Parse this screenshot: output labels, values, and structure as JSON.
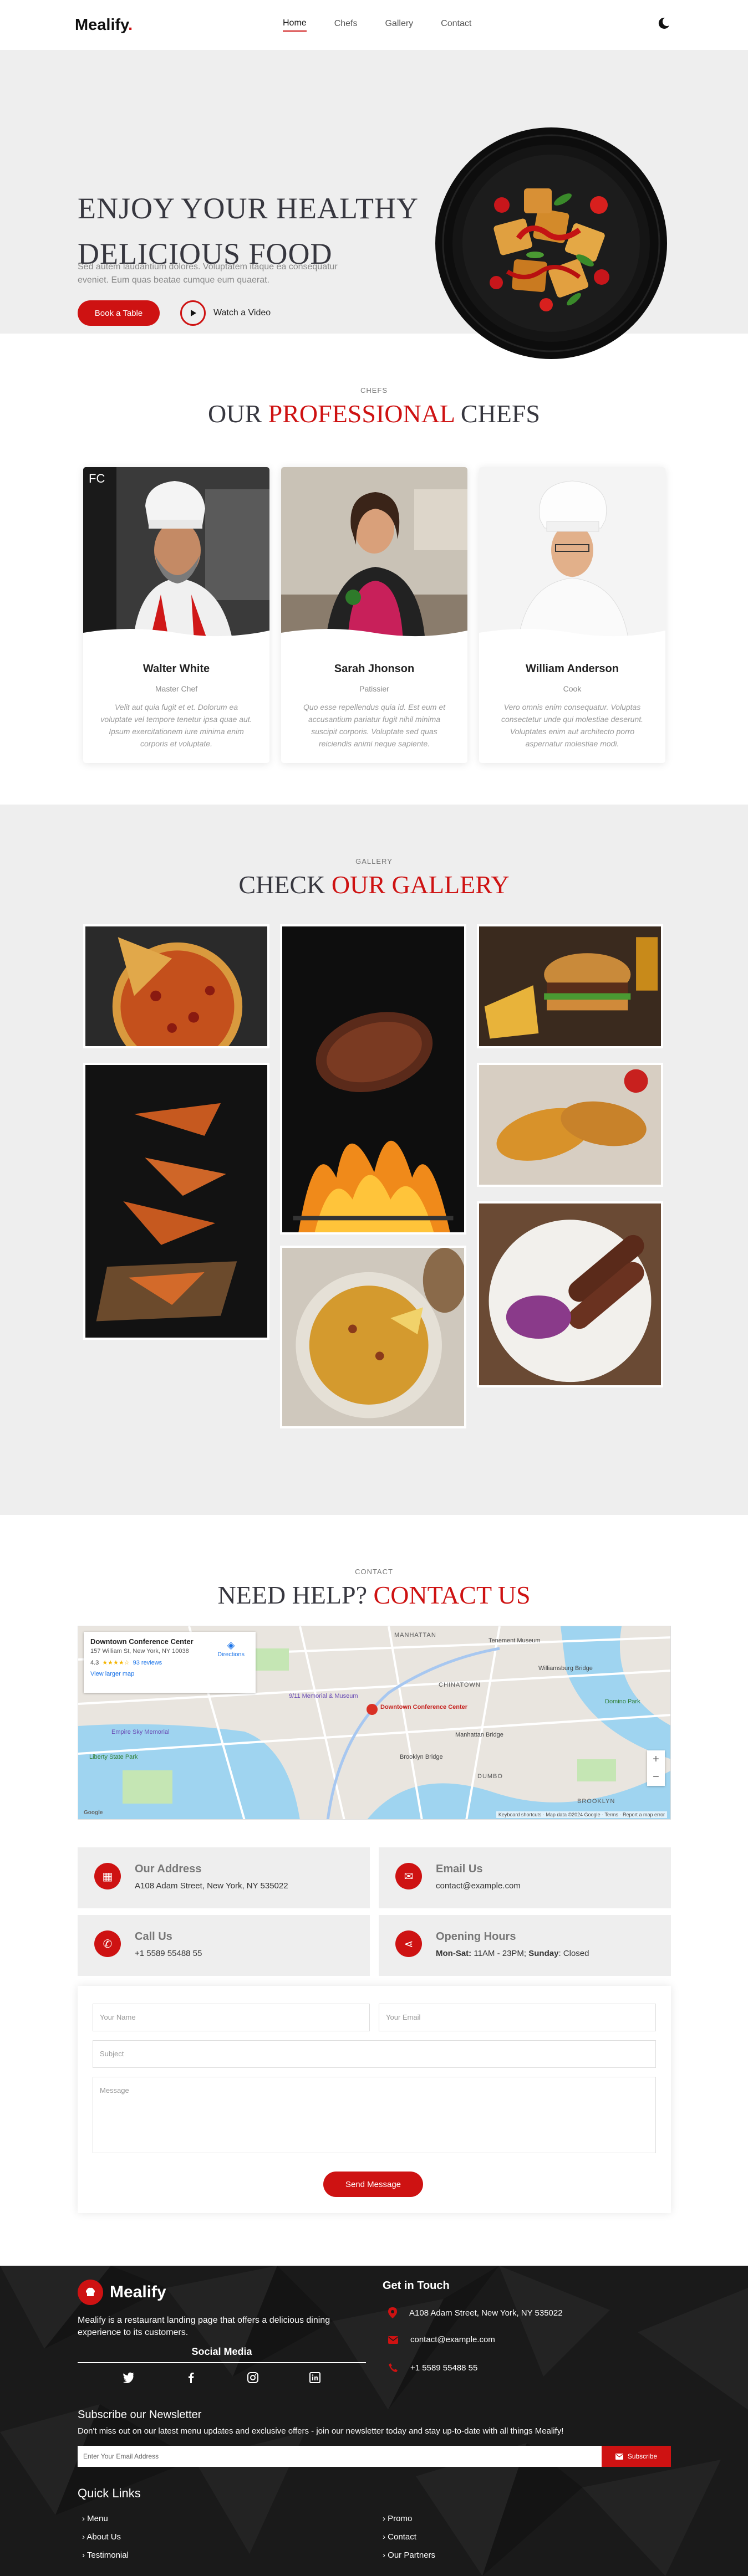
{
  "brand": {
    "name": "Mealify",
    "dot": "."
  },
  "nav": [
    {
      "label": "Home",
      "active": true
    },
    {
      "label": "Chefs"
    },
    {
      "label": "Gallery"
    },
    {
      "label": "Contact"
    }
  ],
  "theme_toggle_icon": "moon-icon",
  "hero": {
    "title_line1": "Enjoy Your Healthy",
    "title_line2": "Delicious Food",
    "text": "Sed autem laudantium dolores. Voluptatem itaque ea consequatur eveniet. Eum quas beatae cumque eum quaerat.",
    "book_label": "Book a Table",
    "watch_label": "Watch a Video"
  },
  "chefs": {
    "subtitle": "CHEFS",
    "title_a": "Our ",
    "title_b": "Professional",
    "title_c": " Chefs",
    "items": [
      {
        "name": "Walter White",
        "role": "Master Chef",
        "desc": "Velit aut quia fugit et et. Dolorum ea voluptate vel tempore tenetur ipsa quae aut. Ipsum exercitationem iure minima enim corporis et voluptate."
      },
      {
        "name": "Sarah Jhonson",
        "role": "Patissier",
        "desc": "Quo esse repellendus quia id. Est eum et accusantium pariatur fugit nihil minima suscipit corporis. Voluptate sed quas reiciendis animi neque sapiente."
      },
      {
        "name": "William Anderson",
        "role": "Cook",
        "desc": "Vero omnis enim consequatur. Voluptas consectetur unde qui molestiae deserunt. Voluptates enim aut architecto porro aspernatur molestiae modi."
      }
    ]
  },
  "gallery": {
    "subtitle": "GALLERY",
    "title_a": "Check ",
    "title_b": "Our Gallery"
  },
  "contact": {
    "subtitle": "CONTACT",
    "title_a": "Need Help? ",
    "title_b": "Contact Us",
    "map": {
      "place": "Downtown Conference Center",
      "address": "157 William St, New York, NY 10038",
      "rating": "4.3",
      "reviews": "93 reviews",
      "larger_map": "View larger map",
      "directions": "Directions",
      "labels": [
        "MANHATTAN",
        "CHINATOWN",
        "Tenement Museum",
        "Williamsburg Bridge",
        "Manhattan Bridge",
        "DUMBO",
        "BROOKLYN",
        "Liberty State Park",
        "Empire Sky Memorial",
        "Google",
        "Keyboard shortcuts",
        "Map data ©2024 Google",
        "Terms",
        "Report a map error",
        "Downtown Conference Center",
        "9/11 Memorial & Museum",
        "Brooklyn Bridge",
        "Domino Park"
      ]
    },
    "info": [
      {
        "title": "Our Address",
        "text": "A108 Adam Street, New York, NY 535022"
      },
      {
        "title": "Email Us",
        "text": "contact@example.com"
      },
      {
        "title": "Call Us",
        "text": "+1 5589 55488 55"
      },
      {
        "title": "Opening Hours",
        "text_b1": "Mon-Sat:",
        "text_1": " 11AM - 23PM; ",
        "text_b2": "Sunday",
        "text_2": ": Closed"
      }
    ],
    "form": {
      "name": "Your Name",
      "email": "Your Email",
      "subject": "Subject",
      "message": "Message",
      "send": "Send Message"
    }
  },
  "footer": {
    "brand": "Mealify",
    "about": "Mealify is a restaurant landing page that offers a delicious dining experience to its customers.",
    "social_title": "Social Media",
    "social_icons": [
      "twitter-icon",
      "facebook-icon",
      "instagram-icon",
      "linkedin-icon"
    ],
    "touch_title": "Get in Touch",
    "touch": [
      "A108 Adam Street, New York, NY 535022",
      "contact@example.com",
      "+1 5589 55488 55"
    ],
    "news_title": "Subscribe our Newsletter",
    "news_text": "Don't miss out on our latest menu updates and exclusive offers - join our newsletter today and stay up-to-date with all things Mealify!",
    "news_placeholder": "Enter Your Email Address",
    "news_button": "Subscribe",
    "links_title": "Quick Links",
    "links_left": [
      "Menu",
      "About Us",
      "Testimonial"
    ],
    "links_right": [
      "Promo",
      "Contact",
      "Our Partners"
    ]
  },
  "colors": {
    "accent": "#ce1212",
    "gray_bg": "#eeeeee",
    "footer_bg": "#1b1b1b"
  }
}
